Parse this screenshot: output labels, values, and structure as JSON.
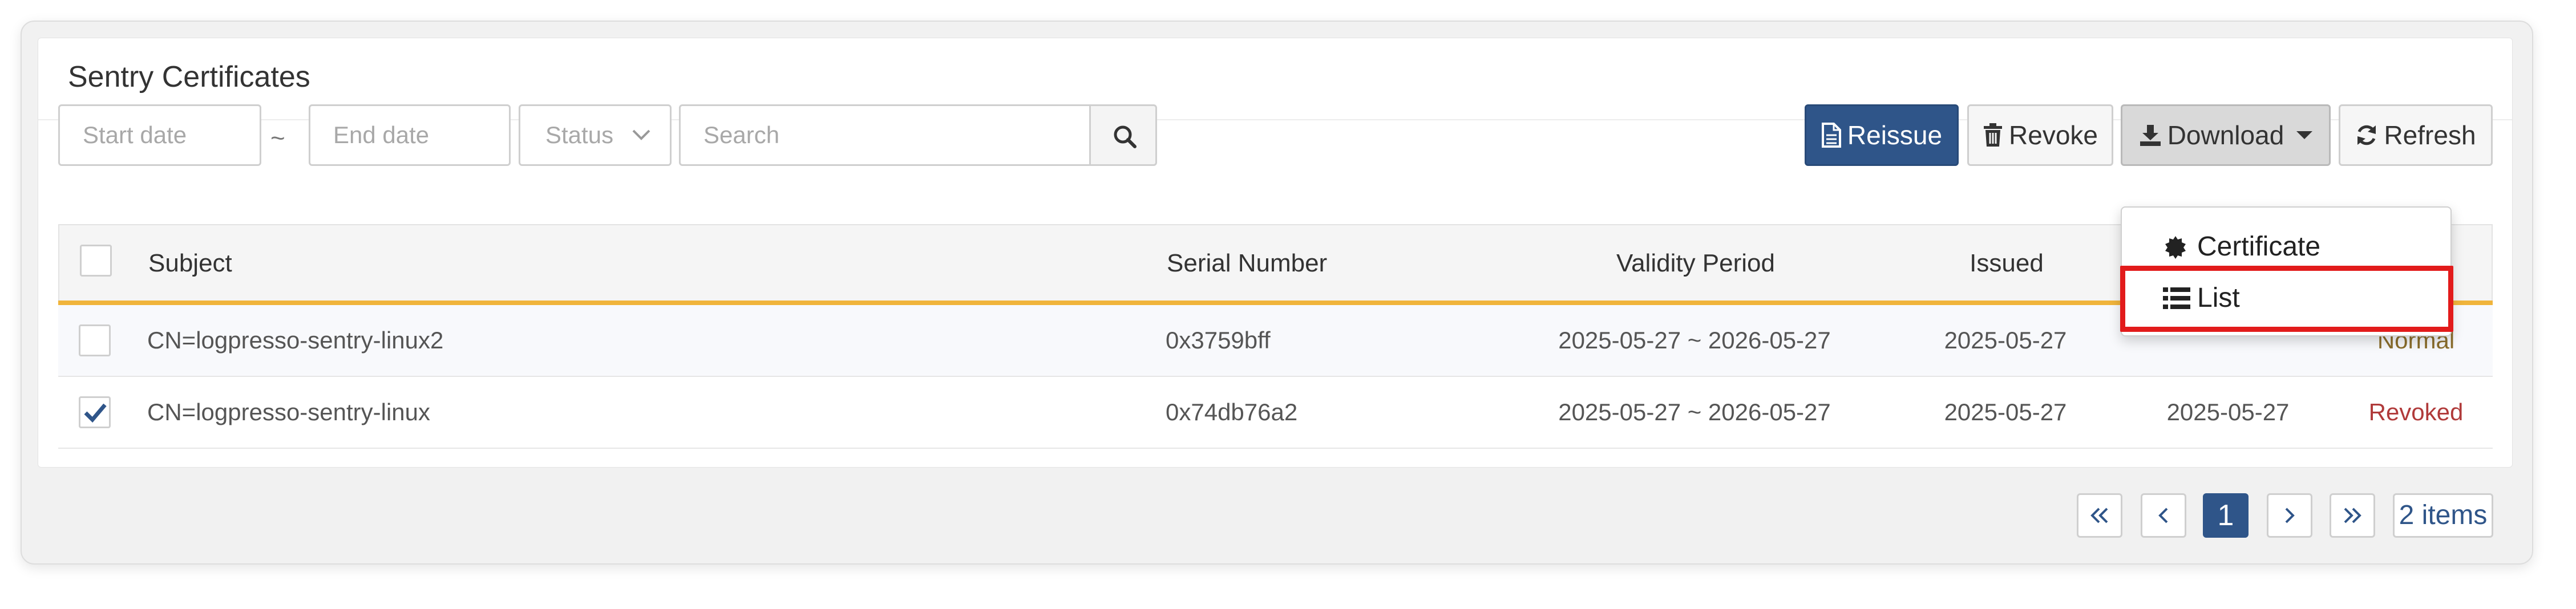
{
  "panel": {
    "title": "Sentry Certificates"
  },
  "filters": {
    "start_date_placeholder": "Start date",
    "range_separator": "~",
    "end_date_placeholder": "End date",
    "status_label": "Status",
    "search_placeholder": "Search"
  },
  "toolbar": {
    "reissue_label": "Reissue",
    "revoke_label": "Revoke",
    "download_label": "Download",
    "refresh_label": "Refresh"
  },
  "download_menu": {
    "items": [
      {
        "label": "Certificate",
        "icon": "certificate-icon"
      },
      {
        "label": "List",
        "icon": "list-icon"
      }
    ]
  },
  "table": {
    "columns": {
      "subject": "Subject",
      "serial": "Serial Number",
      "validity": "Validity Period",
      "issued": "Issued"
    },
    "rows": [
      {
        "checked": false,
        "subject": "CN=logpresso-sentry-linux2",
        "serial": "0x3759bff",
        "validity": "2025-05-27 ~ 2026-05-27",
        "issued": "2025-05-27",
        "revoked_date": "",
        "status": "Normal"
      },
      {
        "checked": true,
        "subject": "CN=logpresso-sentry-linux",
        "serial": "0x74db76a2",
        "validity": "2025-05-27 ~ 2026-05-27",
        "issued": "2025-05-27",
        "revoked_date": "2025-05-27",
        "status": "Revoked"
      }
    ]
  },
  "pagination": {
    "current_page": "1",
    "total_label": "2 items"
  },
  "colors": {
    "primary": "#2f5589",
    "header_accent": "#f0b43c",
    "highlight": "#e21b1b",
    "revoked": "#b03a3a"
  }
}
